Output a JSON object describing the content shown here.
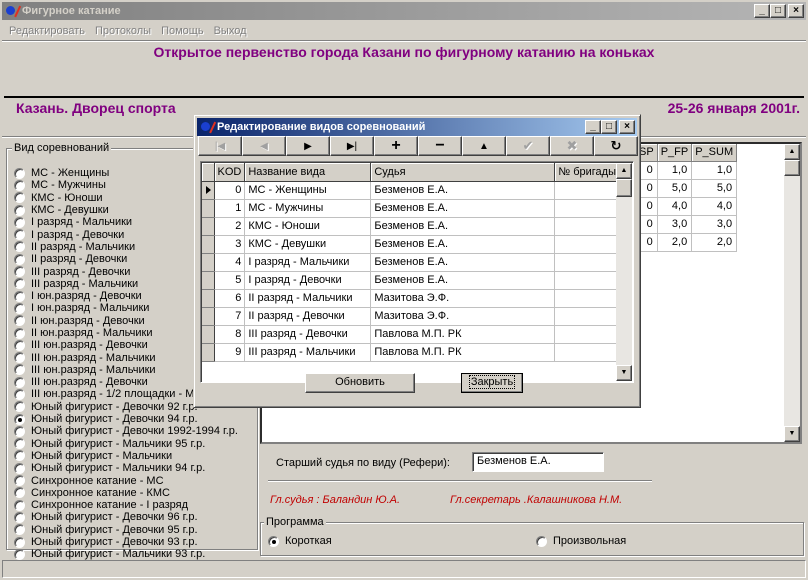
{
  "app": {
    "title": "Фигурное катание"
  },
  "menu": [
    "Редактировать",
    "Протоколы",
    "Помощь",
    "Выход"
  ],
  "header": {
    "title": "Открытое первенство города Казани по фигурному катанию на коньках",
    "venue": "Казань. Дворец спорта",
    "dates": "25-26 января 2001г."
  },
  "categories": {
    "legend": "Вид соревнований",
    "selected_index": 20,
    "items": [
      "МС - Женщины",
      "МС - Мужчины",
      "КМС - Юноши",
      "КМС - Девушки",
      "I разряд - Мальчики",
      "I разряд - Девочки",
      "II разряд - Мальчики",
      "II разряд - Девочки",
      "III разряд - Девочки",
      "III разряд - Мальчики",
      "I юн.разряд  - Девочки",
      "I юн.разряд  - Мальчики",
      "II юн.разряд  - Девочки",
      "II юн.разряд  - Мальчики",
      "III юн.разряд - Девочки",
      "III юн.разряд  - Мальчики",
      "III юн.разряд  - Мальчики",
      "III юн.разряд  - Девочки",
      "III юн.разряд -  1/2 площадки - М",
      "Юный фигурист - Девочки 92 г.р.",
      "Юный фигурист - Девочки 94 г.р.",
      "Юный фигурист - Девочки 1992-1994 г.р.",
      "Юный фигурист - Мальчики 95 г.р.",
      "Юный фигурист - Мальчики",
      "Юный фигурист - Мальчики 94 г.р.",
      "Синхронное катание - МС",
      "Синхронное катание - КМС",
      "Синхронное катание - I разряд",
      "Юный фигурист - Девочки 96 г.р.",
      "Юный фигурист - Девочки 95 г.р.",
      "Юный фигурист - Девочки 93 г.р.",
      "Юный фигурист - Мальчики 93 г.р."
    ]
  },
  "bg_grid": {
    "columns": [
      "SP",
      "P_FP",
      "P_SUM"
    ],
    "rows": [
      [
        "0",
        "1,0",
        "1,0"
      ],
      [
        "0",
        "5,0",
        "5,0"
      ],
      [
        "0",
        "4,0",
        "4,0"
      ],
      [
        "0",
        "3,0",
        "3,0"
      ],
      [
        "0",
        "2,0",
        "2,0"
      ]
    ]
  },
  "referee": {
    "label": "Старший судья по виду (Рефери):",
    "value": "Безменов Е.А."
  },
  "officials": {
    "chief_judge": "Гл.судья :  Баландин Ю.А.",
    "chief_secretary": "Гл.секретарь .Калашникова Н.М."
  },
  "program": {
    "legend": "Программа",
    "short": "Короткая",
    "free": "Произвольная"
  },
  "dialog": {
    "title": "Редактирование видов соревнований",
    "columns": [
      "KOD",
      "Название вида",
      "Судья",
      "№ бригады"
    ],
    "rows": [
      [
        "0",
        "МС - Женщины",
        "Безменов Е.А.",
        ""
      ],
      [
        "1",
        "МС - Мужчины",
        "Безменов Е.А.",
        ""
      ],
      [
        "2",
        "КМС - Юноши",
        "Безменов Е.А.",
        ""
      ],
      [
        "3",
        "КМС - Девушки",
        "Безменов Е.А.",
        ""
      ],
      [
        "4",
        "I разряд - Мальчики",
        "Безменов Е.А.",
        ""
      ],
      [
        "5",
        "I разряд - Девочки",
        "Безменов Е.А.",
        ""
      ],
      [
        "6",
        "II разряд - Мальчики",
        "Мазитова Э.Ф.",
        ""
      ],
      [
        "7",
        "II разряд - Девочки",
        "Мазитова Э.Ф.",
        ""
      ],
      [
        "8",
        "III разряд - Девочки",
        "Павлова М.П.   РК",
        ""
      ],
      [
        "9",
        "III разряд - Мальчики",
        "Павлова М.П.   РК",
        ""
      ]
    ],
    "refresh_label": "Обновить",
    "close_label": "Закрыть"
  }
}
